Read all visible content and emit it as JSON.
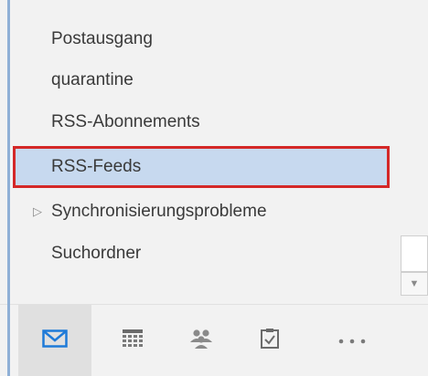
{
  "folders": [
    {
      "label": "Postausgang"
    },
    {
      "label": "quarantine"
    },
    {
      "label": "RSS-Abonnements"
    },
    {
      "label": "RSS-Feeds",
      "selected": true
    },
    {
      "label": "Synchronisierungsprobleme",
      "expandable": true
    },
    {
      "label": "Suchordner"
    }
  ],
  "nav": [
    {
      "icon": "mail-icon",
      "active": true
    },
    {
      "icon": "calendar-icon"
    },
    {
      "icon": "people-icon"
    },
    {
      "icon": "tasks-icon"
    },
    {
      "icon": "more-icon"
    }
  ],
  "colors": {
    "accent": "#1e7ad8",
    "selection": "#c7d9ef",
    "highlight_border": "#d42828"
  }
}
